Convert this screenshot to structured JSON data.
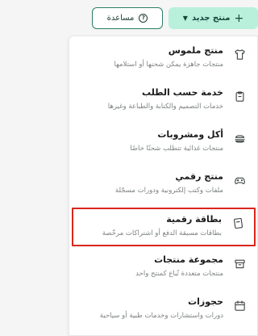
{
  "toolbar": {
    "new_product_label": "منتج جديد",
    "help_label": "مساعدة"
  },
  "menu": {
    "items": [
      {
        "title": "منتج ملموس",
        "description": "منتجات جاهزة يمكن شحنها أو استلامها",
        "icon": "tshirt-icon"
      },
      {
        "title": "خدمة حسب الطلب",
        "description": "خدمات التصميم والكتابة والطباعة وغيرها",
        "icon": "clipboard-icon"
      },
      {
        "title": "أكل ومشروبات",
        "description": "منتجات غذائية تتطلب شحنًا خاصًا",
        "icon": "burger-icon"
      },
      {
        "title": "منتج رقمي",
        "description": "ملفات وكتب إلكترونية ودورات مسجّلة",
        "icon": "gamepad-icon"
      },
      {
        "title": "بطاقة رقمية",
        "description": "بطاقات مسبقة الدفع أو اشتراكات مرخّصة",
        "icon": "card-icon"
      },
      {
        "title": "مجموعة منتجات",
        "description": "منتجات متعددة تُباع كمنتج واحد",
        "icon": "box-icon"
      },
      {
        "title": "حجوزات",
        "description": "دورات واستشارات وخدمات طبية أو سياحية",
        "icon": "calendar-icon"
      }
    ]
  },
  "colors": {
    "accent_bg": "#b9f0dc",
    "accent_border": "#2c7f68",
    "selected_border": "#d9261c"
  }
}
